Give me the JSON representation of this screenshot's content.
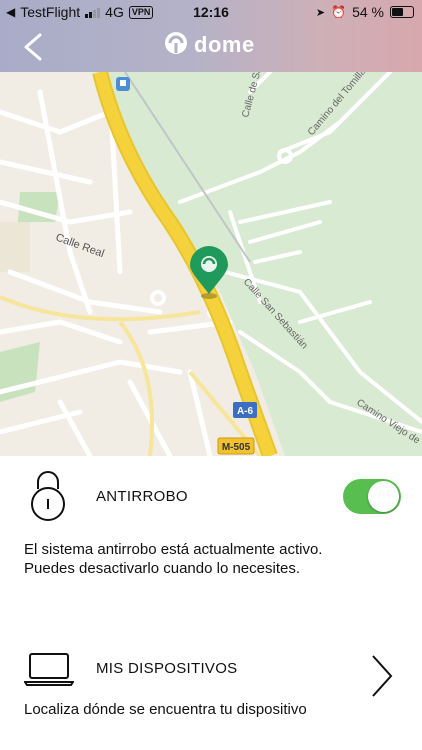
{
  "status_bar": {
    "back_app": "TestFlight",
    "network": "4G",
    "vpn": "VPN",
    "time": "12:16",
    "battery": "54 %"
  },
  "header": {
    "logo_text": "dome"
  },
  "map": {
    "labels": {
      "calle_real": "Calle Real",
      "calle_san_sebastian": "Calle San Sebastián",
      "camino_tomillar": "Camino del Tomillar",
      "calle_de_sa": "Calle de Sa",
      "camino_viejo": "Camino Viejo de",
      "a6": "A-6",
      "m505": "M-505"
    }
  },
  "antitheft": {
    "title": "ANTIRROBO",
    "description_line1": "El sistema antirrobo está actualmente activo.",
    "description_line2": "Puedes desactivarlo cuando lo necesites.",
    "enabled": true
  },
  "devices": {
    "title": "MIS DISPOSITIVOS",
    "description": "Localiza dónde se encuentra tu dispositivo"
  },
  "colors": {
    "toggle_on": "#57be4f",
    "marker": "#1f9a5a",
    "highway": "#f5d23c"
  }
}
